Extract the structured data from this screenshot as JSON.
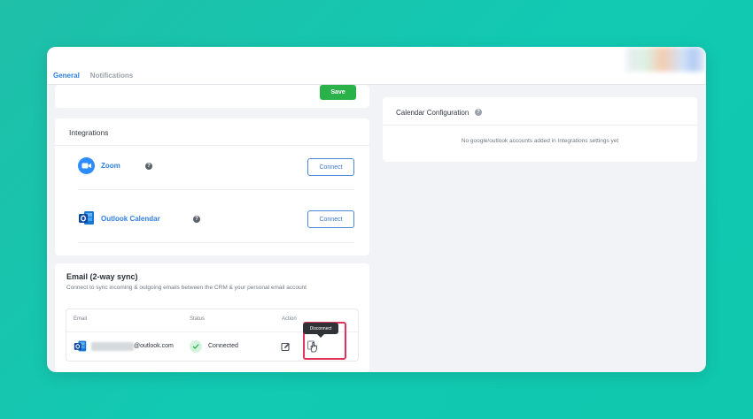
{
  "tabs": [
    {
      "label": "General",
      "active": true
    },
    {
      "label": "Notifications",
      "active": false
    }
  ],
  "top_card": {
    "save_label": "Save"
  },
  "integrations": {
    "title": "Integrations",
    "items": [
      {
        "name": "Zoom",
        "icon": "zoom-icon",
        "button": "Connect"
      },
      {
        "name": "Outlook Calendar",
        "icon": "outlook-icon",
        "button": "Connect"
      }
    ]
  },
  "email_sync": {
    "title": "Email (2-way sync)",
    "subtitle": "Connect to sync incoming & outgoing emails between the CRM & your personal email account",
    "columns": [
      "Email",
      "Status",
      "Action"
    ],
    "row": {
      "email_suffix": "@outlook.com",
      "status": "Connected",
      "tooltip": "Disconnect"
    }
  },
  "calendar_config": {
    "title": "Calendar Configuration",
    "empty_message": "No google/outlook accounts added in Integrations settings yet"
  },
  "colors": {
    "accent": "#2f7fe0",
    "save_green": "#2bb14a",
    "highlight": "#e0345a",
    "background_teal": "#12c9b2"
  }
}
